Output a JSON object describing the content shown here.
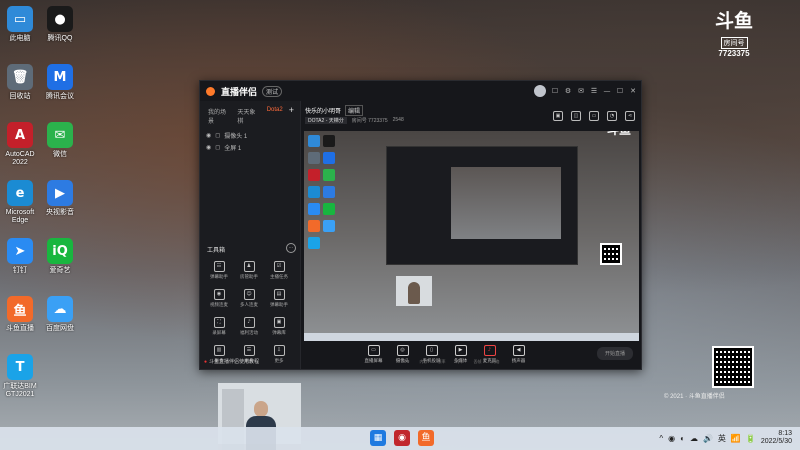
{
  "desktop": {
    "icons": [
      {
        "label": "此电脑",
        "glyph": "▭",
        "color": "#2f8ad8"
      },
      {
        "label": "腾讯QQ",
        "glyph": "●",
        "color": "#1a1a1a"
      },
      {
        "label": "回收站",
        "glyph": "🗑",
        "color": "#5e6b78"
      },
      {
        "label": "腾讯会议",
        "glyph": "M",
        "color": "#1f6fe5"
      },
      {
        "label": "AutoCAD 2022",
        "glyph": "A",
        "color": "#c4202a"
      },
      {
        "label": "微信",
        "glyph": "✉",
        "color": "#2bb24c"
      },
      {
        "label": "Microsoft Edge",
        "glyph": "e",
        "color": "#1b8bd3"
      },
      {
        "label": "央视影音",
        "glyph": "▶",
        "color": "#2d7be2"
      },
      {
        "label": "钉钉",
        "glyph": "➤",
        "color": "#2a8bf2"
      },
      {
        "label": "爱奇艺",
        "glyph": "iQ",
        "color": "#18b63f"
      },
      {
        "label": "斗鱼直播",
        "glyph": "鱼",
        "color": "#f26a2a"
      },
      {
        "label": "百度网盘",
        "glyph": "☁",
        "color": "#3aa0f5"
      },
      {
        "label": "广联达BIM GTJ2021",
        "glyph": "T",
        "color": "#1aa3e8"
      }
    ]
  },
  "logo": {
    "brand": "斗鱼",
    "tag": "房间号",
    "room": "7723375"
  },
  "app": {
    "brand": "直播伴侣",
    "version_pill": "测试",
    "titlebar_buttons": [
      "☐",
      "⚙",
      "✉",
      "☰",
      "—",
      "☐",
      "✕"
    ],
    "left": {
      "tabs": [
        "我的场景",
        "天天象棋",
        "Dota2"
      ],
      "active_tab": "Dota2",
      "scenes": [
        "摄像头 1",
        "全屏 1"
      ],
      "tools_title": "工具箱",
      "tools": [
        {
          "label": "弹幕助手",
          "glyph": "☷"
        },
        {
          "label": "房管助手",
          "glyph": "♟"
        },
        {
          "label": "主播任务",
          "glyph": "☑"
        },
        {
          "label": "视频连麦",
          "glyph": "◉"
        },
        {
          "label": "多人连麦",
          "glyph": "☺"
        },
        {
          "label": "弹幕助手",
          "glyph": "▤"
        },
        {
          "label": "录屏幕",
          "glyph": "⛶"
        },
        {
          "label": "福利活动",
          "glyph": "♪"
        },
        {
          "label": "弹幕库",
          "glyph": "▣"
        },
        {
          "label": "更多",
          "glyph": "▥"
        },
        {
          "label": "更多",
          "glyph": "☰"
        },
        {
          "label": "更多",
          "glyph": "⇩"
        }
      ],
      "footer": "斗鱼直播伴侣使用教程"
    },
    "room": {
      "title": "快乐的小明哥",
      "edit_label": "编辑",
      "category": "DOTA2 - 天梯分",
      "room_id_label": "房间号 7723375",
      "hot": "2548"
    },
    "controls": [
      {
        "label": "直播屏幕",
        "glyph": "▭"
      },
      {
        "label": "摄像头",
        "glyph": "◎"
      },
      {
        "label": "手机投屏",
        "glyph": "▯"
      },
      {
        "label": "多媒体",
        "glyph": "▶"
      },
      {
        "label": "麦克风",
        "glyph": "♪"
      },
      {
        "label": "扬声器",
        "glyph": "◀"
      }
    ],
    "start_live": "开始直播",
    "stats": [
      "CPU",
      "内存",
      "帧率",
      "码率",
      "丢帧",
      "网络"
    ]
  },
  "preview_logo": "斗鱼",
  "watermark": "© 2021 · 斗鱼直播伴侣",
  "taskbar": {
    "apps": [
      {
        "name": "windows-start",
        "glyph": "▦",
        "color": "#1f7ae0"
      },
      {
        "name": "steam",
        "glyph": "◉",
        "color": "#c1272d"
      },
      {
        "name": "douyu",
        "glyph": "鱼",
        "color": "#f26a2a"
      }
    ],
    "tray": [
      "^",
      "◉",
      "◐",
      "☁",
      "🔊",
      "英",
      "📶",
      "🔋"
    ],
    "time": "8:13",
    "date": "2022/5/30"
  }
}
